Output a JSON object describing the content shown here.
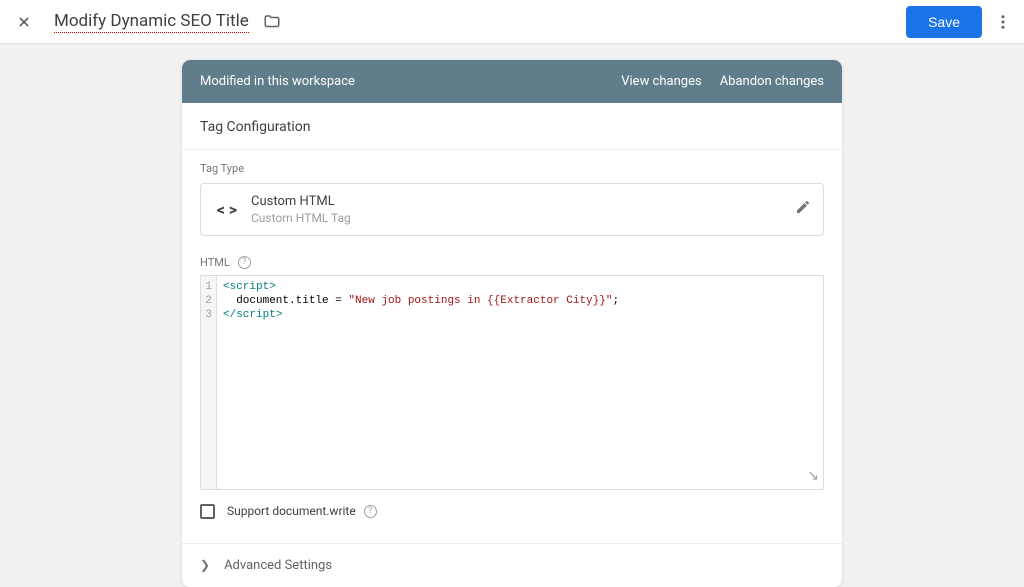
{
  "header": {
    "title": "Modify Dynamic SEO Title",
    "save_label": "Save"
  },
  "banner": {
    "text": "Modified in this workspace",
    "view_changes": "View changes",
    "abandon_changes": "Abandon changes"
  },
  "section": {
    "title": "Tag Configuration",
    "tag_type_label": "Tag Type",
    "tag_type_name": "Custom HTML",
    "tag_type_sub": "Custom HTML Tag",
    "html_label": "HTML",
    "support_docwrite": "Support document.write",
    "advanced_label": "Advanced Settings"
  },
  "code": {
    "line1_open": "<script>",
    "line2_pre": "  document.title = ",
    "line2_str": "\"New job postings in {{Extractor City}}\"",
    "line2_post": ";",
    "line3_close": "</scr",
    "line3_close2": "ipt>",
    "ln1": "1",
    "ln2": "2",
    "ln3": "3"
  }
}
